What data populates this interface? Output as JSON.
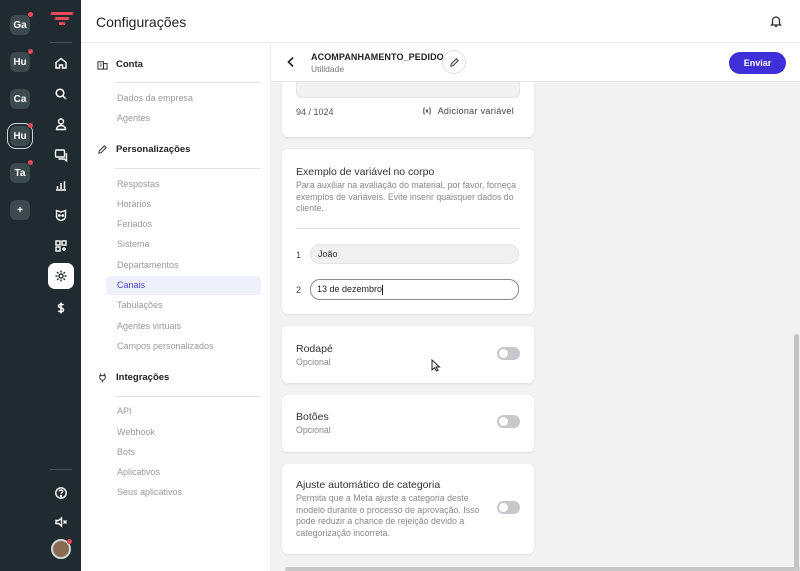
{
  "rail": {
    "workspaces": [
      {
        "label": "Ga",
        "dot": true
      },
      {
        "label": "Hu",
        "dot": true
      },
      {
        "label": "Ca",
        "dot": false
      },
      {
        "label": "Hu",
        "dot": true,
        "active": true
      },
      {
        "label": "Ta",
        "dot": true
      },
      {
        "label": "+",
        "dot": false
      }
    ],
    "icons": [
      "home-icon",
      "search-icon",
      "contacts-icon",
      "chat-icon",
      "reports-icon",
      "bot-icon",
      "apps-icon",
      "settings-icon",
      "billing-icon"
    ],
    "bottom_icons": [
      "help-icon",
      "mute-icon"
    ]
  },
  "header": {
    "title": "Configurações"
  },
  "settings_nav": {
    "sections": [
      {
        "label": "Conta",
        "items": [
          "Dados da empresa",
          "Agentes"
        ]
      },
      {
        "label": "Personalizações",
        "items": [
          "Respostas",
          "Horários",
          "Feriados",
          "Sistema",
          "Departamentos",
          "Canais",
          "Tabulações",
          "Agentes virtuais",
          "Campos personalizados"
        ]
      },
      {
        "label": "Integrações",
        "items": [
          "API",
          "Webhook",
          "Bots",
          "Aplicativos",
          "Seus aplicativos"
        ]
      }
    ],
    "active_item": "Canais"
  },
  "template": {
    "name": "ACOMPANHAMENTO_PEDIDO",
    "category": "Utilidade",
    "send_label": "Enviar"
  },
  "body_card": {
    "counter": "94 / 1024",
    "add_variable_label": "Adicionar variável"
  },
  "example_card": {
    "title": "Exemplo de variável no corpo",
    "description": "Para auxiliar na avaliação do material, por favor, forneça exemplos de variáveis. Evite inserir quaisquer dados do cliente.",
    "variables": [
      {
        "index": "1",
        "value": "João"
      },
      {
        "index": "2",
        "value": "13 de dezembro"
      }
    ]
  },
  "footer_card": {
    "title": "Rodapé",
    "subtitle": "Opcional",
    "enabled": false
  },
  "buttons_card": {
    "title": "Botões",
    "subtitle": "Opcional",
    "enabled": false
  },
  "auto_category_card": {
    "title": "Ajuste automático de categoria",
    "description": "Permita que a Meta ajuste a categoria deste modelo durante o processo de aprovação. Isso pode reduzir a chance de rejeição devido a categorização incorreta.",
    "enabled": false
  },
  "colors": {
    "accent": "#3e2fd8",
    "rail_bg": "#1f2b2e",
    "content_bg": "#f2f2f2",
    "notify": "#e5485a"
  }
}
